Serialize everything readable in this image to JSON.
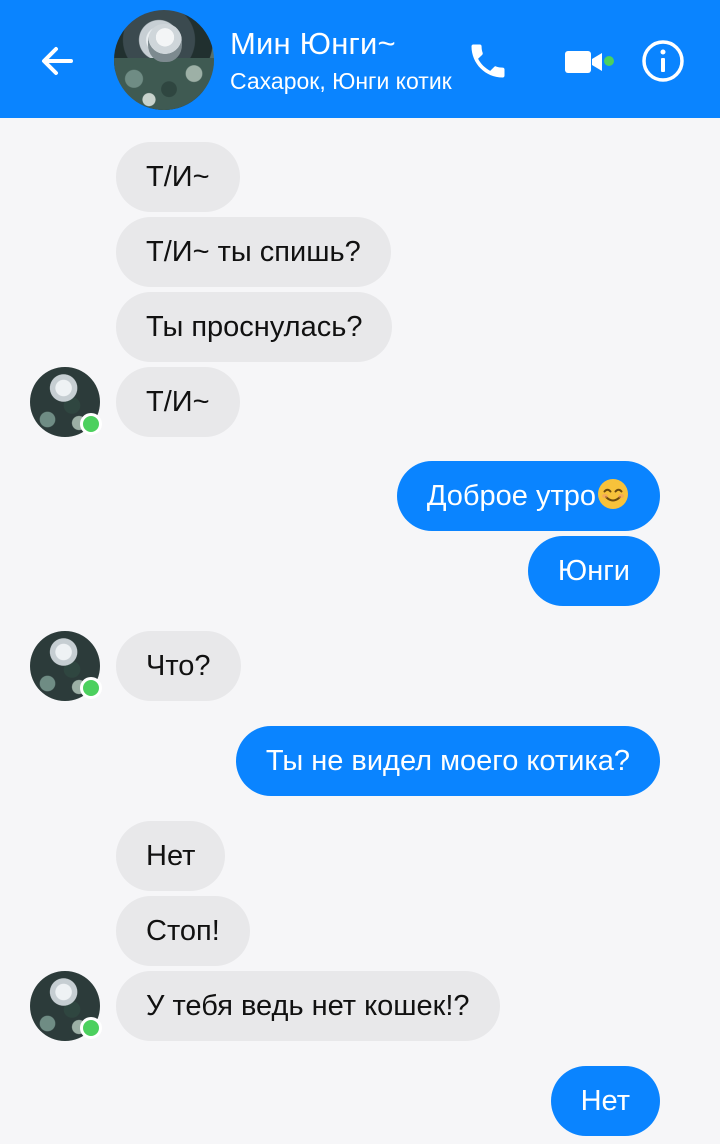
{
  "header": {
    "contact_name": "Мин Юнги~",
    "nicknames": "Сахарок, Юнги котик",
    "accent_color": "#0a84ff",
    "online_color": "#4cd05e",
    "icons": [
      "back-arrow-icon",
      "phone-icon",
      "video-camera-icon",
      "info-icon"
    ]
  },
  "messages": [
    {
      "from": "contact",
      "text": "Т/И~"
    },
    {
      "from": "contact",
      "text": "Т/И~ ты спишь?"
    },
    {
      "from": "contact",
      "text": "Ты проснулась?"
    },
    {
      "from": "contact",
      "text": "Т/И~"
    },
    {
      "from": "me",
      "text": "Доброе утро",
      "emoji": "smiling-face-emoji"
    },
    {
      "from": "me",
      "text": "Юнги"
    },
    {
      "from": "contact",
      "text": "Что?"
    },
    {
      "from": "me",
      "text": "Ты не видел моего котика?"
    },
    {
      "from": "contact",
      "text": "Нет"
    },
    {
      "from": "contact",
      "text": "Стоп!"
    },
    {
      "from": "contact",
      "text": "У тебя ведь нет кошек!?"
    },
    {
      "from": "me",
      "text": "Нет"
    }
  ]
}
